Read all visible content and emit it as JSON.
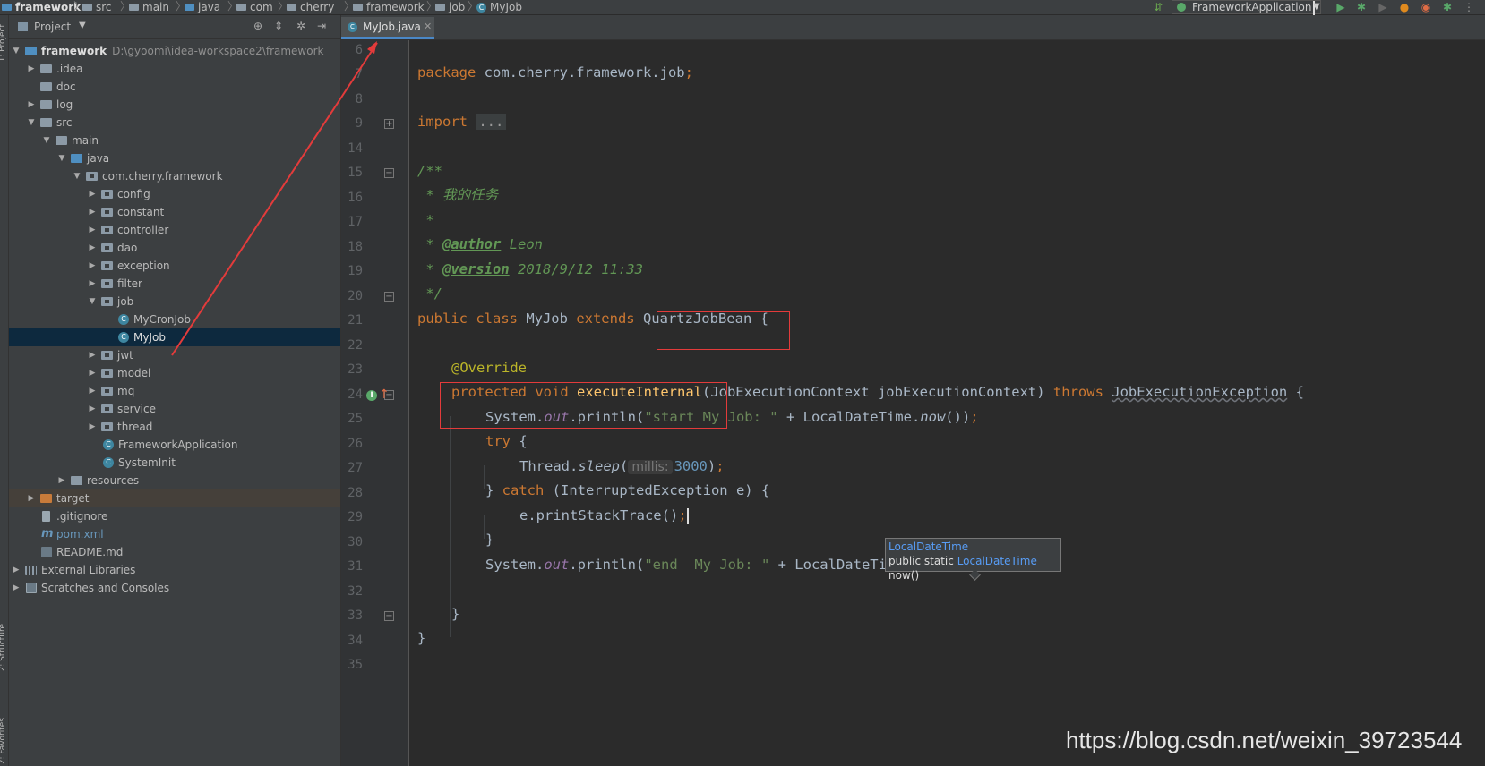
{
  "navbar": {
    "crumbs": [
      "framework",
      "src",
      "main",
      "java",
      "com",
      "cherry",
      "framework",
      "job",
      "MyJob"
    ],
    "run_config": "FrameworkApplication"
  },
  "project_panel": {
    "title": "Project",
    "tree": [
      {
        "label": "framework",
        "path": "D:\\gyoomi\\idea-workspace2\\framework"
      },
      {
        "label": ".idea"
      },
      {
        "label": "doc"
      },
      {
        "label": "log"
      },
      {
        "label": "src"
      },
      {
        "label": "main"
      },
      {
        "label": "java"
      },
      {
        "label": "com.cherry.framework"
      },
      {
        "label": "config"
      },
      {
        "label": "constant"
      },
      {
        "label": "controller"
      },
      {
        "label": "dao"
      },
      {
        "label": "exception"
      },
      {
        "label": "filter"
      },
      {
        "label": "job"
      },
      {
        "label": "MyCronJob"
      },
      {
        "label": "MyJob"
      },
      {
        "label": "jwt"
      },
      {
        "label": "model"
      },
      {
        "label": "mq"
      },
      {
        "label": "service"
      },
      {
        "label": "thread"
      },
      {
        "label": "FrameworkApplication"
      },
      {
        "label": "SystemInit"
      },
      {
        "label": "resources"
      },
      {
        "label": "target"
      },
      {
        "label": ".gitignore"
      },
      {
        "label": "pom.xml"
      },
      {
        "label": "README.md"
      },
      {
        "label": "External Libraries"
      },
      {
        "label": "Scratches and Consoles"
      }
    ]
  },
  "side_tabs": [
    "1: Project",
    "2: Structure",
    "2: Favorites"
  ],
  "editor": {
    "tab": "MyJob.java",
    "line_numbers": [
      "6",
      "7",
      "8",
      "9",
      "14",
      "15",
      "16",
      "17",
      "18",
      "19",
      "20",
      "21",
      "22",
      "23",
      "24",
      "25",
      "26",
      "27",
      "28",
      "29",
      "30",
      "31",
      "32",
      "33",
      "34",
      "35"
    ],
    "code": {
      "l7_pkg_kw": "package",
      "l7_pkg_name": " com.cherry.framework.job",
      "l7_semi": ";",
      "l9_import": "import",
      "l9_fold": "...",
      "l15": "/**",
      "l16": " * 我的任务",
      "l17": " *",
      "l18_pre": " * ",
      "l18_tag": "@author",
      "l18_val": " Leon",
      "l19_pre": " * ",
      "l19_tag": "@version",
      "l19_val": " 2018/9/12 11:33",
      "l20": " */",
      "l21_kw": "public class",
      "l21_name": " MyJob ",
      "l21_ext": "extends",
      "l21_super": " QuartzJobBean {",
      "l23_ann": "@Override",
      "l24_kw": "protected void",
      "l24_fn": "executeInternal",
      "l24_params": "(JobExecutionContext jobExecutionContext) ",
      "l24_throws": "throws",
      "l24_exc": "JobExecutionException",
      "l24_end": " {",
      "l25_a": "System.",
      "l25_out": "out",
      "l25_b": ".println(",
      "l25_str": "\"start My Job: \"",
      "l25_c": " + LocalDateTime.",
      "l25_now": "now",
      "l25_d": "())",
      "l25_semi": ";",
      "l26_kw": "try",
      "l26_b": " {",
      "l27_a": "Thread.",
      "l27_sleep": "sleep",
      "l27_b": "(",
      "l27_hint": "millis:",
      "l27_num": "3000",
      "l27_c": ")",
      "l27_semi": ";",
      "l28_a": "} ",
      "l28_kw": "catch",
      "l28_b": " (InterruptedException e) {",
      "l29_a": "e.printStackTrace()",
      "l29_semi": ";",
      "l30": "}",
      "l31_a": "System.",
      "l31_out": "out",
      "l31_b": ".println(",
      "l31_str": "\"end  My Job: \"",
      "l31_c": " + LocalDateTime.",
      "l31_now": "now",
      "l31_d": "())",
      "l31_semi": ";",
      "l33": "}",
      "l34": "}"
    },
    "tooltip": {
      "line1": "LocalDateTime",
      "line2_pre": "public static ",
      "line2_link": "LocalDateTime",
      "line2_post": " now()"
    }
  },
  "watermark": "https://blog.csdn.net/weixin_39723544",
  "colors": {
    "annotation_box": "#e33b3b",
    "selection": "#0d293e",
    "accent": "#4a88c7"
  }
}
